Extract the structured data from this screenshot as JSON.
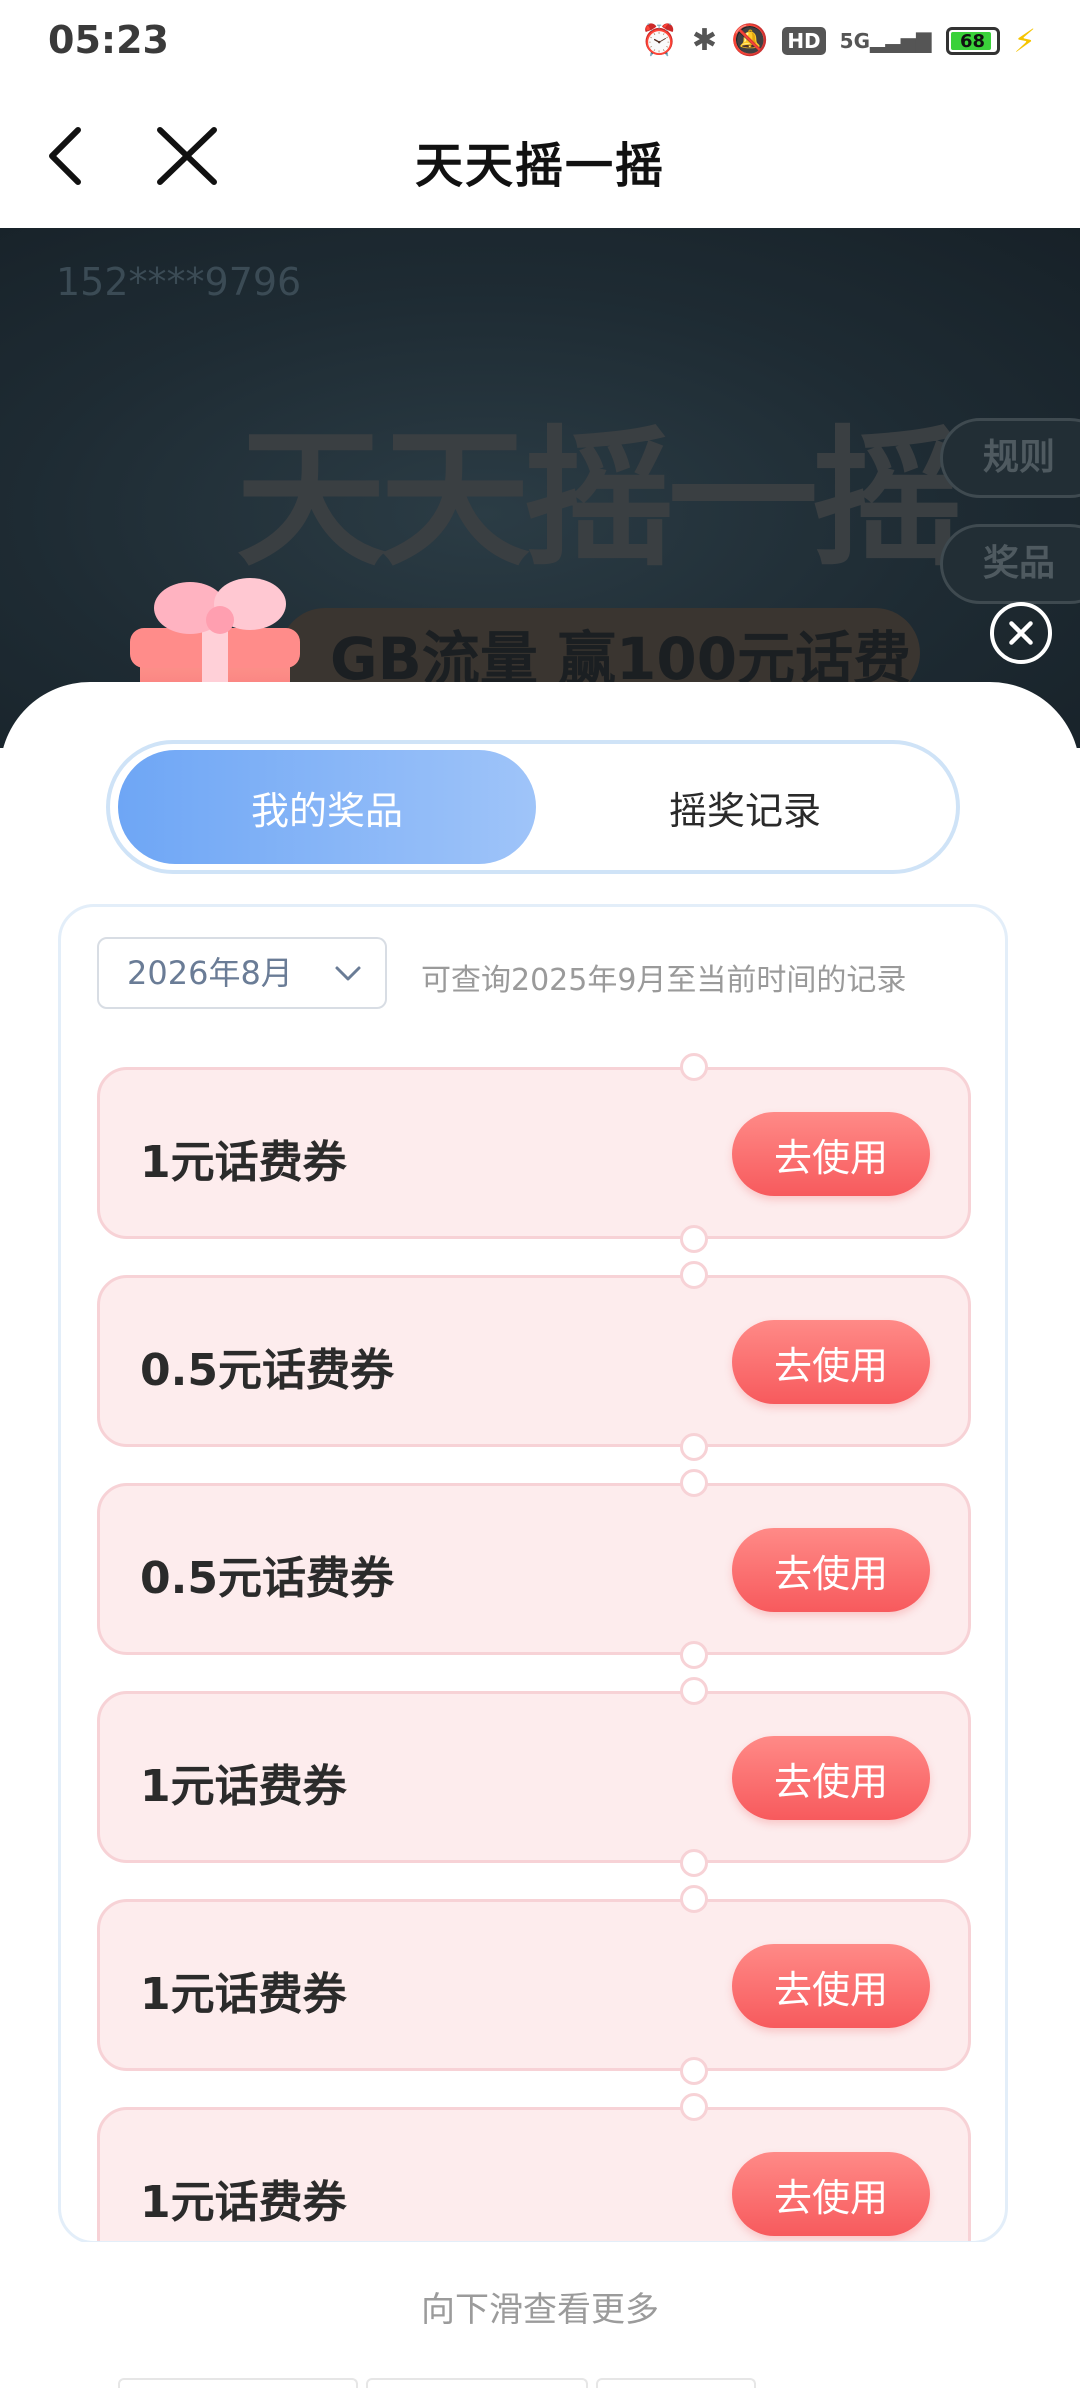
{
  "status_bar": {
    "time": "05:23",
    "network": "5G",
    "hd_label": "HD",
    "battery_level": "68"
  },
  "nav": {
    "title": "天天摇一摇"
  },
  "banner": {
    "phone_masked": "152****9796",
    "big_title": "天天摇一摇",
    "subtitle": "GB流量 赢100元话费",
    "rules_label": "规则",
    "prizes_label": "奖品"
  },
  "tabs": {
    "active": "我的奖品",
    "inactive": "摇奖记录"
  },
  "filter": {
    "month": "2026年8月",
    "hint": "可查询2025年9月至当前时间的记录"
  },
  "prizes": [
    {
      "name": "1元话费券",
      "action": "去使用"
    },
    {
      "name": "0.5元话费券",
      "action": "去使用"
    },
    {
      "name": "0.5元话费券",
      "action": "去使用"
    },
    {
      "name": "1元话费券",
      "action": "去使用"
    },
    {
      "name": "1元话费券",
      "action": "去使用"
    },
    {
      "name": "1元话费券",
      "action": "去使用"
    }
  ],
  "footer": {
    "more_hint": "向下滑查看更多"
  },
  "colors": {
    "tab_active": "#6ea6f5",
    "use_button": "#f75a5d",
    "card_bg": "#fdeced"
  }
}
